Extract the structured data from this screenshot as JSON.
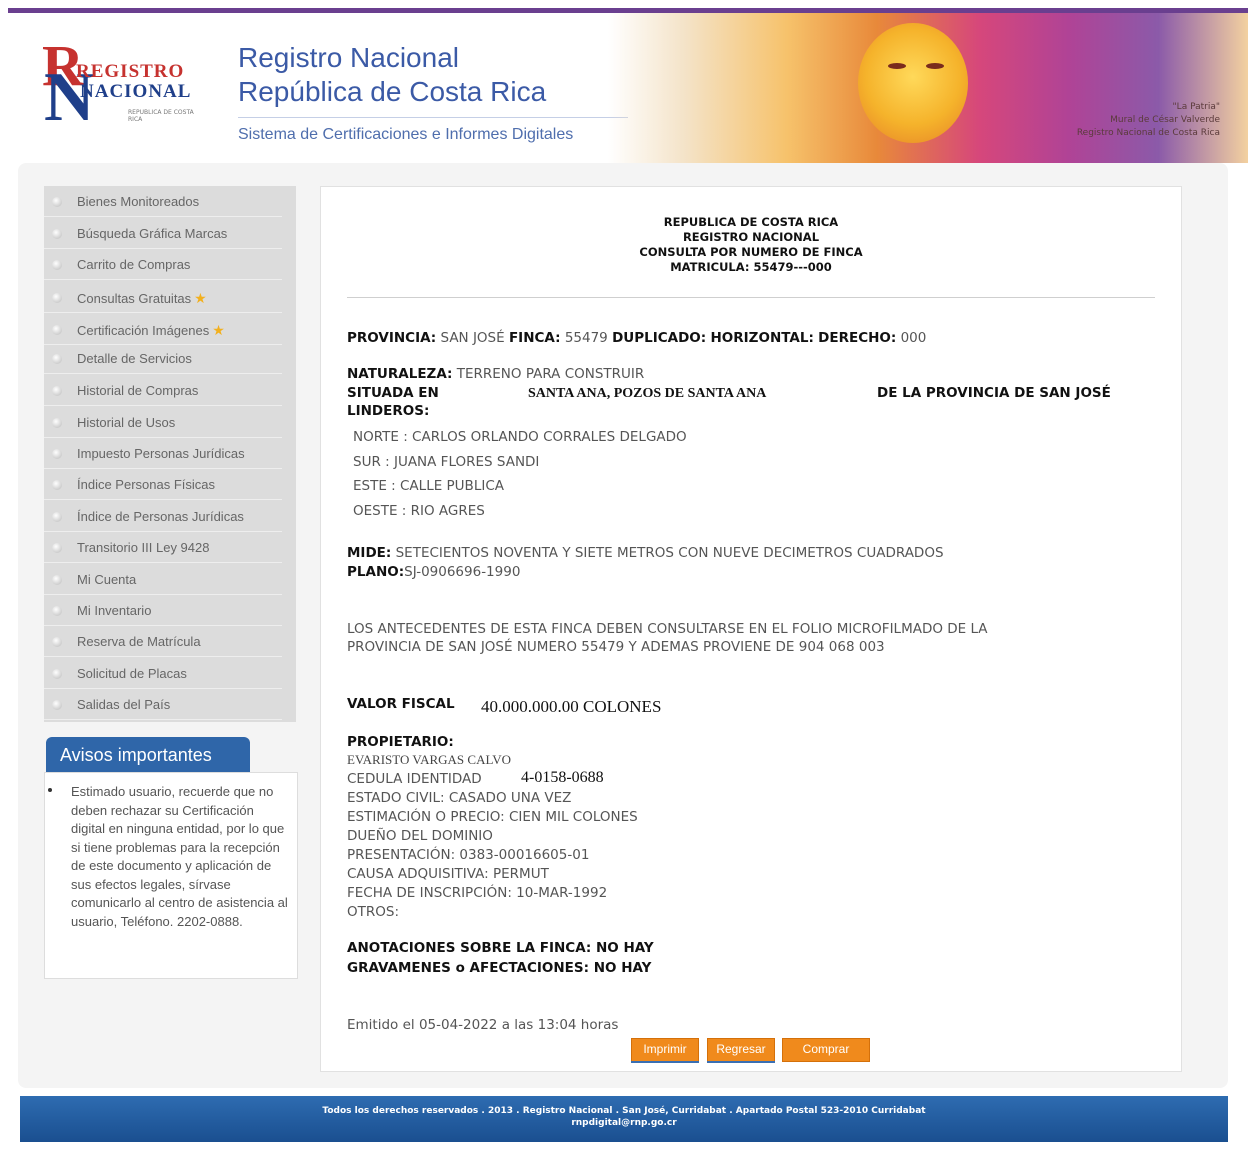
{
  "header": {
    "logo": {
      "line1": "REGISTRO",
      "line2": "NACIONAL",
      "sub": "REPUBLICA DE COSTA RICA"
    },
    "title_line1": "Registro Nacional",
    "title_line2": "República de Costa Rica",
    "subtitle": "Sistema de Certificaciones e Informes Digitales",
    "art_caption": [
      "\"La Patria\"",
      "Mural de César Valverde",
      "Registro Nacional de Costa Rica"
    ]
  },
  "sidebar": {
    "items": [
      {
        "label": "Bienes Monitoreados",
        "star": false
      },
      {
        "label": "Búsqueda Gráfica Marcas",
        "star": false
      },
      {
        "label": "Carrito de Compras",
        "star": false
      },
      {
        "label": "Consultas Gratuitas",
        "star": true
      },
      {
        "label": "Certificación Imágenes",
        "star": true
      },
      {
        "label": "Detalle de Servicios",
        "star": false
      },
      {
        "label": "Historial de Compras",
        "star": false
      },
      {
        "label": "Historial de Usos",
        "star": false
      },
      {
        "label": "Impuesto Personas Jurídicas",
        "star": false
      },
      {
        "label": "Índice Personas Físicas",
        "star": false
      },
      {
        "label": "Índice de Personas Jurídicas",
        "star": false
      },
      {
        "label": "Transitorio III Ley 9428",
        "star": false
      },
      {
        "label": "Mi Cuenta",
        "star": false
      },
      {
        "label": "Mi Inventario",
        "star": false
      },
      {
        "label": "Reserva de Matrícula",
        "star": false
      },
      {
        "label": "Solicitud de Placas",
        "star": false
      },
      {
        "label": "Salidas del País",
        "star": false
      }
    ],
    "avisos_title": "Avisos importantes",
    "avisos_text": "Estimado usuario, recuerde que no deben rechazar su Certificación digital en ninguna entidad, por lo que si tiene problemas para la recepción de este documento y aplicación de sus efectos legales, sírvase comunicarlo al centro de asistencia al usuario, Teléfono. 2202-0888."
  },
  "document": {
    "head": [
      "REPUBLICA DE COSTA RICA",
      "REGISTRO NACIONAL",
      "CONSULTA POR NUMERO DE FINCA",
      "MATRICULA: 55479---000"
    ],
    "provincia_label": "PROVINCIA:",
    "provincia": "SAN JOSÉ",
    "finca_label": "FINCA:",
    "finca": "55479",
    "duplicado_label": "DUPLICADO:",
    "horizontal_label": "HORIZONTAL:",
    "derecho_label": "DERECHO:",
    "derecho": "000",
    "naturaleza_label": "NATURALEZA:",
    "naturaleza": "TERRENO PARA CONSTRUIR",
    "situada_label": "SITUADA EN",
    "situada": "SANTA ANA, POZOS DE SANTA ANA",
    "provincia_suffix": "DE LA PROVINCIA DE SAN JOSÉ",
    "linderos_label": "LINDEROS:",
    "linderos": [
      "NORTE : CARLOS ORLANDO CORRALES DELGADO",
      "SUR : JUANA FLORES SANDI",
      "ESTE : CALLE PUBLICA",
      "OESTE : RIO AGRES"
    ],
    "mide_label": "MIDE:",
    "mide": "SETECIENTOS NOVENTA Y SIETE METROS CON NUEVE DECIMETROS CUADRADOS",
    "plano_label": "PLANO:",
    "plano": "SJ-0906696-1990",
    "antecedentes_1": "LOS ANTECEDENTES DE ESTA FINCA DEBEN CONSULTARSE EN EL FOLIO MICROFILMADO DE LA",
    "antecedentes_2": "PROVINCIA DE SAN JOSÉ NUMERO 55479 Y ADEMAS PROVIENE DE 904 068 003",
    "valor_label": "VALOR FISCAL",
    "valor": "40.000.000.00 COLONES",
    "propietario_label": "PROPIETARIO:",
    "propietario": "EVARISTO VARGAS CALVO",
    "cedula_label": "CEDULA IDENTIDAD",
    "cedula": "4-0158-0688",
    "estado_civil": "ESTADO CIVIL: CASADO UNA VEZ",
    "estimacion": "ESTIMACIÓN O PRECIO: CIEN MIL COLONES",
    "dueno": "DUEÑO DEL DOMINIO",
    "presentacion": "PRESENTACIÓN: 0383-00016605-01",
    "causa": "CAUSA ADQUISITIVA: PERMUT",
    "fecha": "FECHA DE INSCRIPCIÓN: 10-MAR-1992",
    "otros": "OTROS:",
    "anotaciones": "ANOTACIONES SOBRE LA FINCA: NO HAY",
    "gravamenes": "GRAVAMENES o AFECTACIONES: NO HAY",
    "emitido": "Emitido el 05-04-2022 a las 13:04 horas"
  },
  "buttons": {
    "imprimir": "Imprimir",
    "regresar": "Regresar",
    "comprar": "Comprar"
  },
  "footer": {
    "line1": "Todos los derechos reservados . 2013 . Registro Nacional . San José, Curridabat . Apartado Postal 523-2010 Curridabat",
    "line2": "rnpdigital@rnp.go.cr"
  },
  "colors": {
    "accent": "#2f66a9",
    "button": "#f08a1c",
    "topbar": "#6a3f8f"
  }
}
